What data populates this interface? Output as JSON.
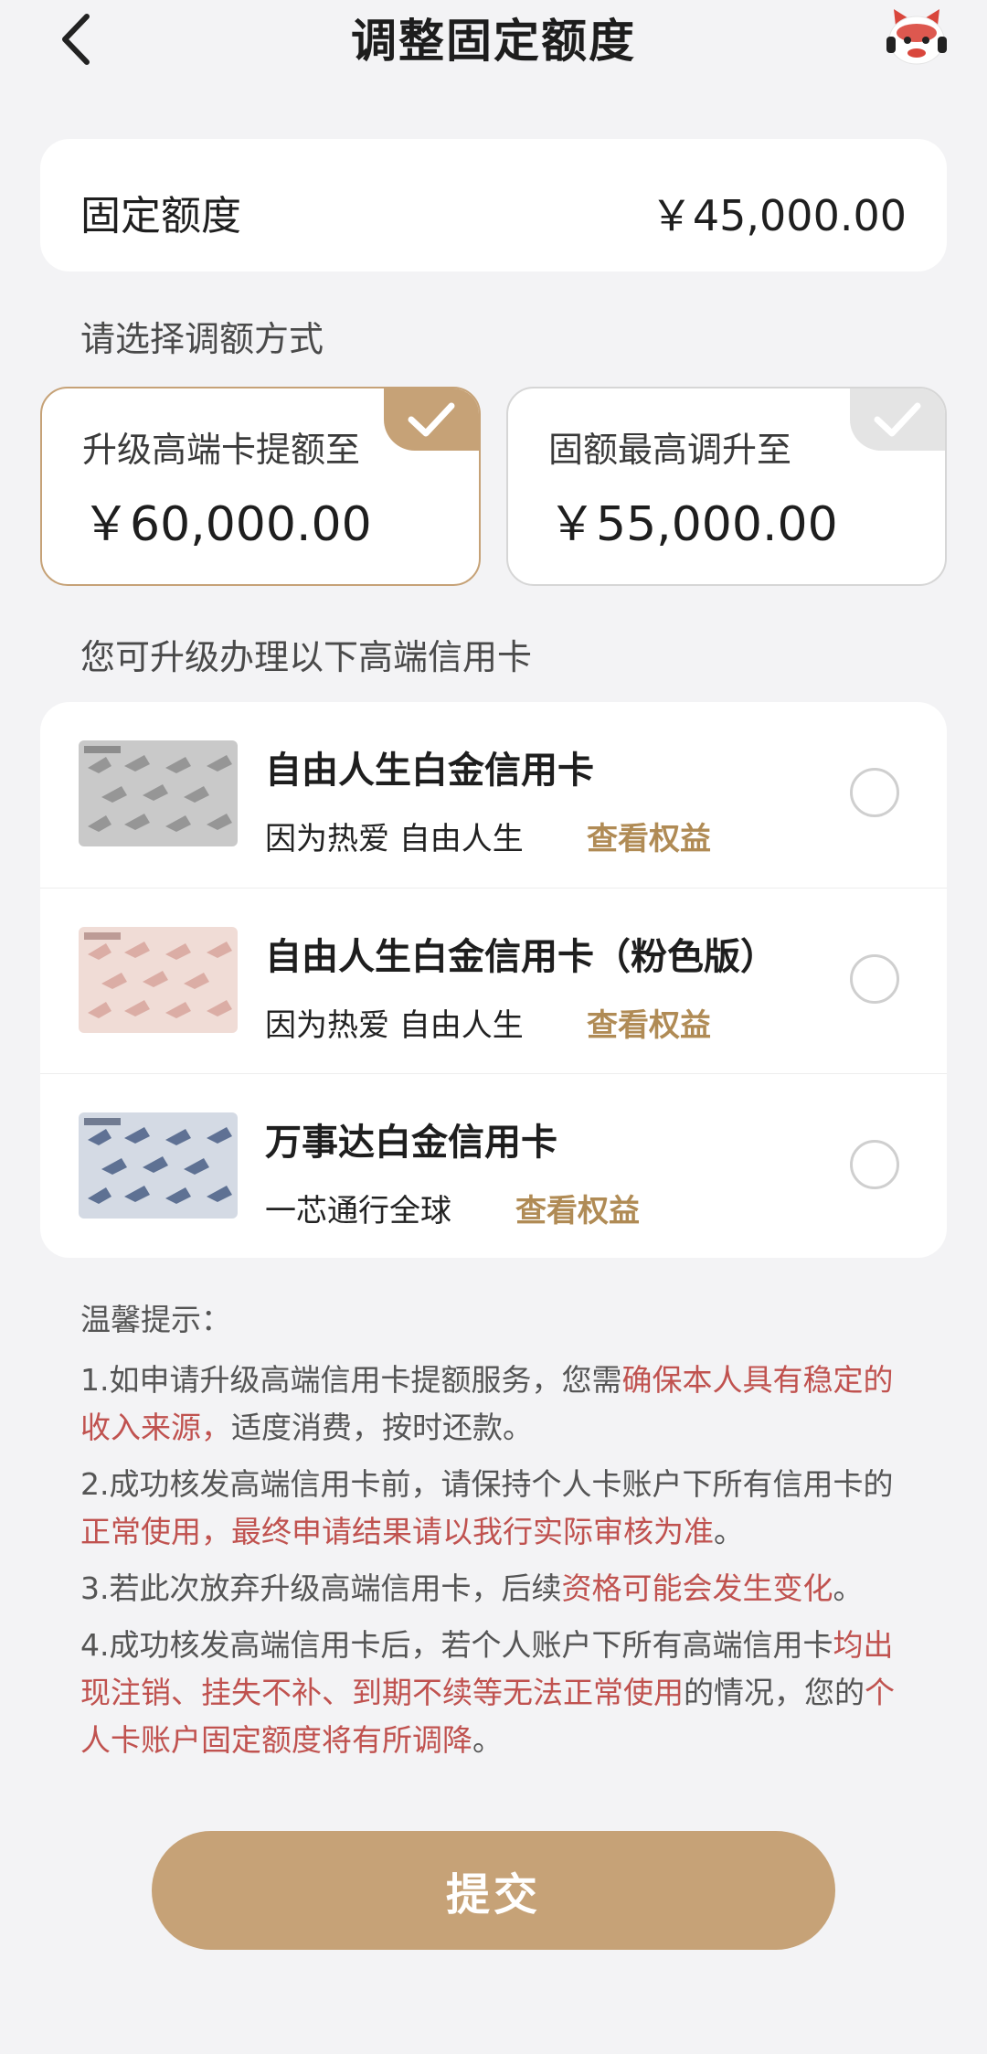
{
  "header": {
    "title": "调整固定额度",
    "back_icon": "chevron-left-icon",
    "mascot_icon": "mascot-avatar-icon"
  },
  "fixed_amount": {
    "label": "固定额度",
    "value": "￥45,000.00"
  },
  "adjust_section": {
    "label": "请选择调额方式",
    "options": [
      {
        "label": "升级高端卡提额至",
        "value": "￥60,000.00",
        "selected": true
      },
      {
        "label": "固额最高调升至",
        "value": "￥55,000.00",
        "selected": false
      }
    ]
  },
  "cards_section": {
    "label": "您可升级办理以下高端信用卡",
    "link_label": "查看权益",
    "cards": [
      {
        "name": "自由人生白金信用卡",
        "desc": "因为热爱 自由人生",
        "style": "silver"
      },
      {
        "name": "自由人生白金信用卡（粉色版）",
        "desc": "因为热爱 自由人生",
        "style": "pink"
      },
      {
        "name": "万事达白金信用卡",
        "desc": "一芯通行全球",
        "style": "blue"
      }
    ]
  },
  "tips": {
    "title": "温馨提示：",
    "items": [
      {
        "parts": [
          "1.如申请升级高端信用卡提额服务，您需",
          "确保本人具有稳定的收入来源，",
          "适度消费，按时还款。"
        ]
      },
      {
        "parts": [
          "2.成功核发高端信用卡前，请保持个人卡账户下所有信用卡的",
          "正常使用，最终申请结果请以我行实际审核为准",
          "。"
        ]
      },
      {
        "parts": [
          "3.若此次放弃升级高端信用卡，后续",
          "资格可能会发生变化",
          "。"
        ]
      },
      {
        "parts": [
          "4.成功核发高端信用卡后，若个人账户下所有高端信用卡",
          "均出现注销、挂失不补、到期不续等无法正常使用",
          "的情况，您的",
          "个人卡账户固定额度将有所调降",
          "。"
        ]
      }
    ]
  },
  "submit_label": "提交",
  "colors": {
    "accent": "#c6a277",
    "link": "#b08b55",
    "warning": "#c0524f",
    "background": "#f3f3f5"
  }
}
